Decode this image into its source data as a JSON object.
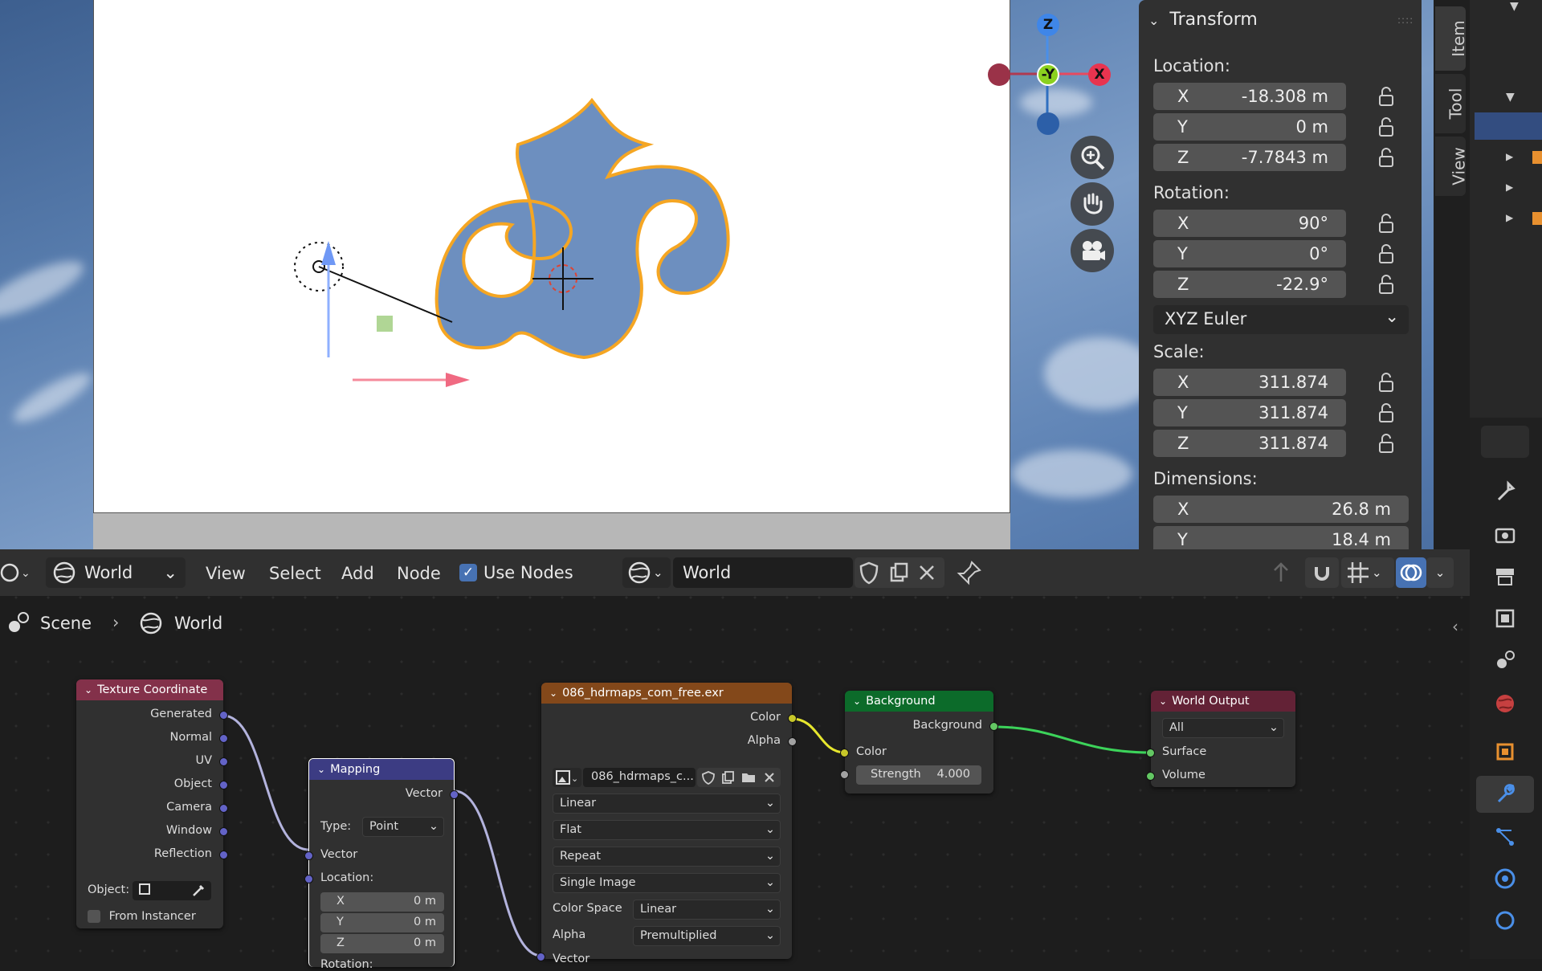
{
  "viewport": {
    "gizmo": {
      "z": "Z",
      "neg_y": "-Y",
      "x": "X"
    },
    "nav_icons": [
      "zoom-icon",
      "hand-pan-icon",
      "camera-view-icon"
    ]
  },
  "npanel": {
    "section_title": "Transform",
    "location_label": "Location:",
    "location": [
      {
        "axis": "X",
        "value": "-18.308 m"
      },
      {
        "axis": "Y",
        "value": "0 m"
      },
      {
        "axis": "Z",
        "value": "-7.7843 m"
      }
    ],
    "rotation_label": "Rotation:",
    "rotation": [
      {
        "axis": "X",
        "value": "90°"
      },
      {
        "axis": "Y",
        "value": "0°"
      },
      {
        "axis": "Z",
        "value": "-22.9°"
      }
    ],
    "rotation_mode": "XYZ Euler",
    "scale_label": "Scale:",
    "scale": [
      {
        "axis": "X",
        "value": "311.874"
      },
      {
        "axis": "Y",
        "value": "311.874"
      },
      {
        "axis": "Z",
        "value": "311.874"
      }
    ],
    "dimensions_label": "Dimensions:",
    "dimensions": [
      {
        "axis": "X",
        "value": "26.8 m"
      },
      {
        "axis": "Y",
        "value": "18.4 m"
      }
    ],
    "tabs": [
      "Item",
      "Tool",
      "View"
    ]
  },
  "node_editor": {
    "header": {
      "world_selector": "World",
      "menus": [
        "View",
        "Select",
        "Add",
        "Node"
      ],
      "use_nodes_label": "Use Nodes",
      "datablock_name": "World"
    },
    "breadcrumb": {
      "scene": "Scene",
      "world": "World"
    },
    "nodes": {
      "texture_coordinate": {
        "title": "Texture Coordinate",
        "outputs": [
          "Generated",
          "Normal",
          "UV",
          "Object",
          "Camera",
          "Window",
          "Reflection"
        ],
        "object_label": "Object:",
        "from_instancer": "From Instancer"
      },
      "mapping": {
        "title": "Mapping",
        "output": "Vector",
        "type_label": "Type:",
        "type_value": "Point",
        "vector_input": "Vector",
        "location_label": "Location:",
        "location": [
          {
            "axis": "X",
            "value": "0 m"
          },
          {
            "axis": "Y",
            "value": "0 m"
          },
          {
            "axis": "Z",
            "value": "0 m"
          }
        ],
        "rotation_label": "Rotation:"
      },
      "environment": {
        "title": "086_hdrmaps_com_free.exr",
        "outputs": [
          "Color",
          "Alpha"
        ],
        "image_name": "086_hdrmaps_c...",
        "interpolation": "Linear",
        "projection": "Flat",
        "extension": "Repeat",
        "source": "Single Image",
        "color_space_label": "Color Space",
        "color_space": "Linear",
        "alpha_label": "Alpha",
        "alpha": "Premultiplied",
        "vector_input": "Vector"
      },
      "background": {
        "title": "Background",
        "output": "Background",
        "color_input": "Color",
        "strength_label": "Strength",
        "strength_value": "4.000"
      },
      "world_output": {
        "title": "World Output",
        "target": "All",
        "inputs": [
          "Surface",
          "Volume"
        ]
      }
    }
  },
  "colors": {
    "tex_coord_header": "#83314a",
    "mapping_header": "#3c3c83",
    "env_header": "#83481a",
    "background_header": "#0c6b2a",
    "output_header": "#632236",
    "selection_orange": "#f5a623"
  }
}
